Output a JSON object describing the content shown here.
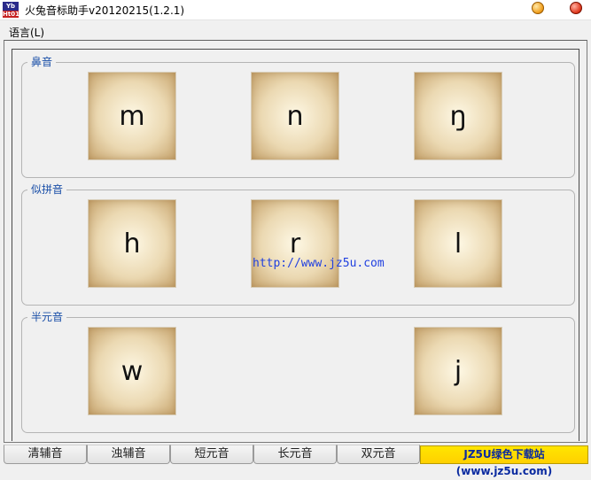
{
  "window": {
    "title": "火兔音标助手v20120215(1.2.1)",
    "icon_text_top": "Yb",
    "icon_text_bottom": "Ht01"
  },
  "menu": {
    "items": [
      {
        "label": "语言(L)"
      }
    ]
  },
  "groups": [
    {
      "label": "鼻音",
      "cards": [
        {
          "symbol": "m"
        },
        {
          "symbol": "n"
        },
        {
          "symbol": "ŋ"
        }
      ]
    },
    {
      "label": "似拼音",
      "cards": [
        {
          "symbol": "h"
        },
        {
          "symbol": "r"
        },
        {
          "symbol": "l"
        }
      ]
    },
    {
      "label": "半元音",
      "cards": [
        {
          "symbol": "w"
        },
        {
          "symbol": "j"
        }
      ]
    }
  ],
  "watermark": "http://www.jz5u.com",
  "tabs": [
    {
      "label": "清辅音"
    },
    {
      "label": "浊辅音"
    },
    {
      "label": "短元音"
    },
    {
      "label": "长元音"
    },
    {
      "label": "双元音"
    }
  ],
  "badge": "JZ5U绿色下载站(www.jz5u.com)",
  "colors": {
    "group_label": "#1a4fa8",
    "watermark": "#2040e0",
    "badge_bg": "#ffe600",
    "badge_text": "#0a2aa0"
  }
}
